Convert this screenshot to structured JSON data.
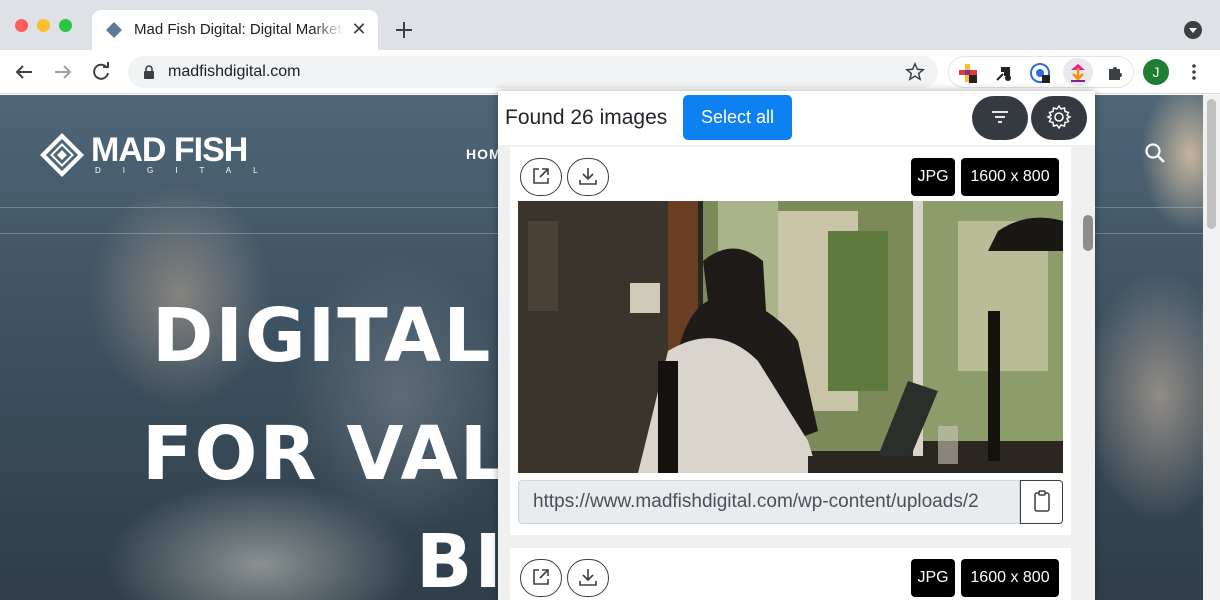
{
  "browser": {
    "tab": {
      "title": "Mad Fish Digital: Digital Marketing Agency",
      "close_glyph": "✕"
    },
    "new_tab_glyph": "+",
    "address": {
      "url": "madfishdigital.com"
    },
    "profile_initial": "J"
  },
  "website": {
    "logo_text": "MAD FISH",
    "logo_sub": "DIGITAL",
    "nav_item": "HOM",
    "hero_lines": [
      "DIGITAL",
      "FOR VAL",
      "BI"
    ]
  },
  "popup": {
    "found_text": "Found 26 images",
    "select_all_label": "Select all",
    "images": [
      {
        "format": "JPG",
        "dimensions": "1600 x 800",
        "url": "https://www.madfishdigital.com/wp-content/uploads/2"
      },
      {
        "format": "JPG",
        "dimensions": "1600 x 800"
      }
    ]
  },
  "icons": [
    "site-favicon-icon",
    "plus-icon",
    "tab-search-icon",
    "back-arrow-icon",
    "forward-arrow-icon",
    "reload-icon",
    "lock-icon",
    "star-icon",
    "color-picker-extension-icon",
    "tool-extension-icon",
    "privacy-extension-icon",
    "image-downloader-extension-icon",
    "puzzle-icon",
    "kebab-menu-icon",
    "filter-icon",
    "gear-icon",
    "open-external-icon",
    "download-icon",
    "clipboard-icon",
    "search-icon"
  ],
  "colors": {
    "select_all": "#0d80f2",
    "round_buttons": "#343a40",
    "profile": "#1e7e34"
  }
}
